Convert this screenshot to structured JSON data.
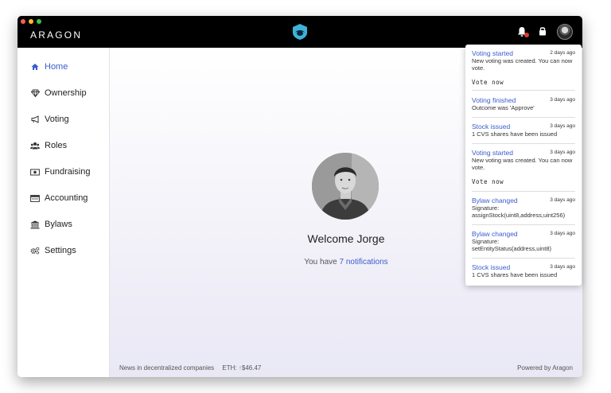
{
  "app": {
    "brand": "ARAGON"
  },
  "sidebar": {
    "items": [
      {
        "label": "Home",
        "icon": "home-icon",
        "active": true
      },
      {
        "label": "Ownership",
        "icon": "diamond-icon"
      },
      {
        "label": "Voting",
        "icon": "megaphone-icon"
      },
      {
        "label": "Roles",
        "icon": "users-icon"
      },
      {
        "label": "Fundraising",
        "icon": "money-icon"
      },
      {
        "label": "Accounting",
        "icon": "ledger-icon"
      },
      {
        "label": "Bylaws",
        "icon": "bank-icon"
      },
      {
        "label": "Settings",
        "icon": "gears-icon"
      }
    ]
  },
  "main": {
    "welcome": "Welcome Jorge",
    "notif_prefix": "You have ",
    "notif_link": "7 notifications"
  },
  "footer": {
    "news": "News in decentralized companies",
    "eth_label": "ETH:",
    "eth_arrow": "↑",
    "eth_value": "$46.47",
    "powered": "Powered by Aragon"
  },
  "notifications": [
    {
      "title": "Voting started",
      "time": "2 days ago",
      "body": "New voting was created. You can now vote.",
      "action": "Vote now"
    },
    {
      "title": "Voting finished",
      "time": "3 days ago",
      "body": "Outcome was 'Approve'"
    },
    {
      "title": "Stock issued",
      "time": "3 days ago",
      "body": "1 CVS shares have been issued"
    },
    {
      "title": "Voting started",
      "time": "3 days ago",
      "body": "New voting was created. You can now vote.",
      "action": "Vote now"
    },
    {
      "title": "Bylaw changed",
      "time": "3 days ago",
      "body": "Signature: assignStock(uint8,address,uint256)"
    },
    {
      "title": "Bylaw changed",
      "time": "3 days ago",
      "body": "Signature: setEntityStatus(address,uint8)"
    },
    {
      "title": "Stock issued",
      "time": "3 days ago",
      "body": "1 CVS shares have been issued"
    }
  ],
  "colors": {
    "accent": "#3a5ccc",
    "titlebar": "#000000",
    "alert": "#e03c31"
  }
}
